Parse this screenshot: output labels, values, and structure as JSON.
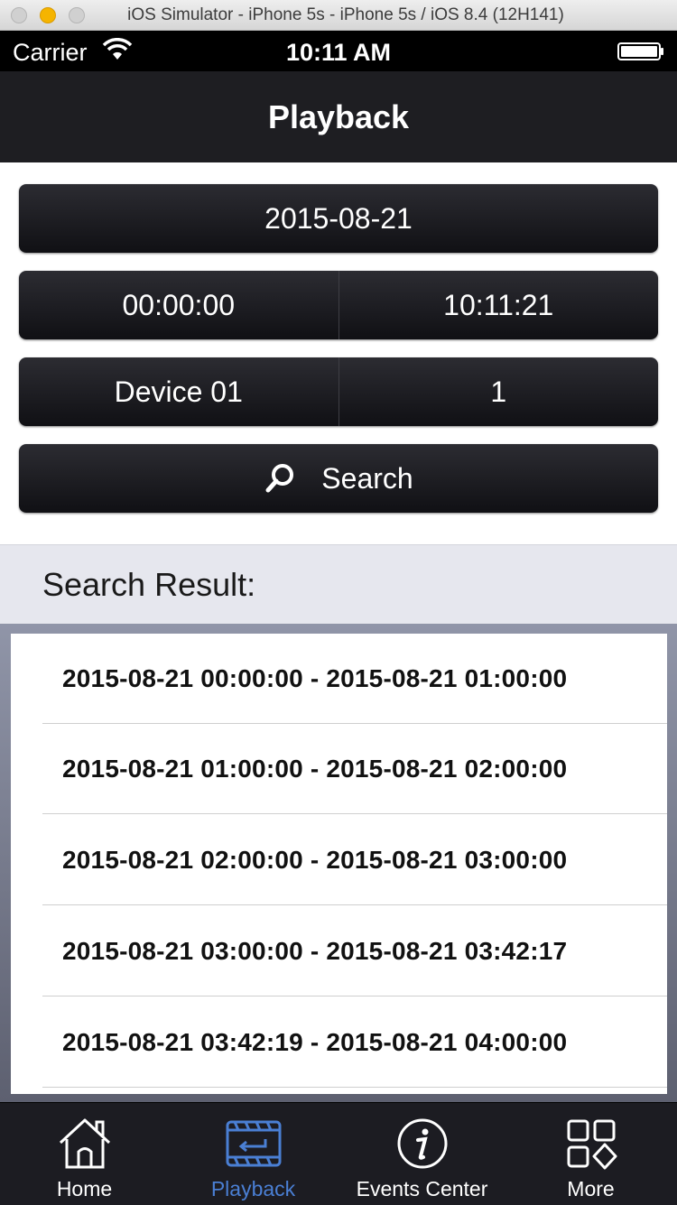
{
  "simulator": {
    "title": "iOS Simulator - iPhone 5s - iPhone 5s / iOS 8.4 (12H141)"
  },
  "status_bar": {
    "carrier": "Carrier",
    "time": "10:11 AM"
  },
  "nav": {
    "title": "Playback"
  },
  "controls": {
    "date": "2015-08-21",
    "start_time": "00:00:00",
    "end_time": "10:11:21",
    "device": "Device 01",
    "channel": "1",
    "search_label": "Search"
  },
  "results": {
    "header": "Search Result:",
    "items": [
      "2015-08-21 00:00:00 - 2015-08-21 01:00:00",
      "2015-08-21 01:00:00 - 2015-08-21 02:00:00",
      "2015-08-21 02:00:00 - 2015-08-21 03:00:00",
      "2015-08-21 03:00:00 - 2015-08-21 03:42:17",
      "2015-08-21 03:42:19 - 2015-08-21 04:00:00"
    ]
  },
  "tabs": [
    {
      "label": "Home",
      "icon": "home-icon",
      "active": false
    },
    {
      "label": "Playback",
      "icon": "playback-icon",
      "active": true
    },
    {
      "label": "Events Center",
      "icon": "info-icon",
      "active": false
    },
    {
      "label": "More",
      "icon": "more-icon",
      "active": false
    }
  ],
  "colors": {
    "active_tab": "#4a7fd4",
    "nav_background": "#1e1e22"
  }
}
